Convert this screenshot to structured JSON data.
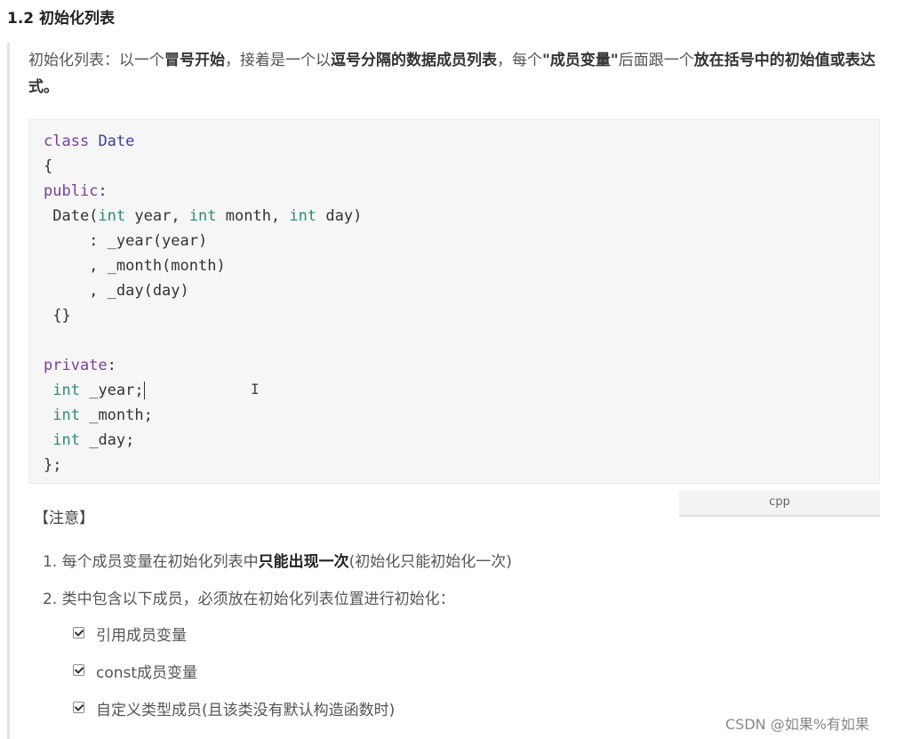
{
  "heading": "1.2 初始化列表",
  "intro": {
    "p1": "初始化列表：以一个",
    "b1": "冒号开始",
    "p2": "，接着是一个以",
    "b2": "逗号分隔的数据成员列表",
    "p3": "，每个",
    "b3": "\"成员变量\"",
    "p4": "后面跟一个",
    "b4": "放在括号中的初始值或表达式。"
  },
  "code": {
    "language": "cpp",
    "kw_class": "class",
    "class_name": "Date",
    "open_brace": "{",
    "kw_public": "public",
    "colon": ":",
    "ctor_name": " Date(",
    "int": "int",
    "p_year": " year, ",
    "p_month": " month, ",
    "p_day": " day)",
    "init_year": "     : _year(year)",
    "init_month": "     , _month(month)",
    "init_day": "     , _day(day)",
    "ctor_body": " {}",
    "kw_private": "private",
    "m_year": " _year;",
    "m_month": " _month;",
    "m_day": " _day;",
    "close": "};"
  },
  "text_cursor": "I",
  "note": {
    "title": "【注意】",
    "item1_pre": "1. 每个成员变量在初始化列表中",
    "item1_bold": "只能出现一次",
    "item1_post": "(初始化只能初始化一次)",
    "item2": "2. 类中包含以下成员，必须放在初始化列表位置进行初始化：",
    "checks": [
      "引用成员变量",
      "const成员变量",
      "自定义类型成员(且该类没有默认构造函数时)"
    ]
  },
  "watermark": "CSDN @如果%有如果"
}
